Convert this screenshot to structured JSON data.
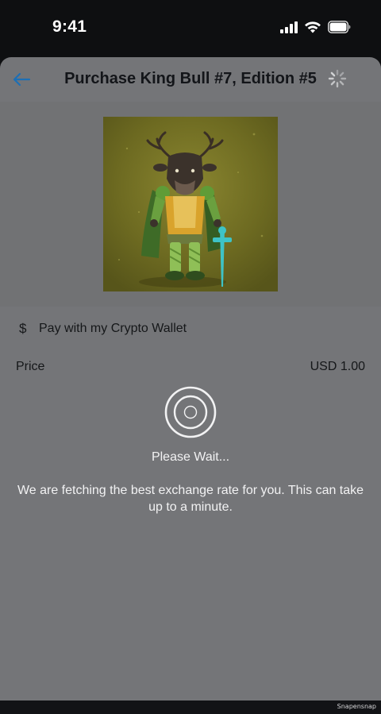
{
  "status_bar": {
    "time": "9:41",
    "icons": [
      "signal-icon",
      "wifi-icon",
      "battery-icon"
    ]
  },
  "header": {
    "back_icon": "arrow-left-icon",
    "title": "Purchase King Bull #7, Edition #5",
    "spinner_icon": "loading-spinner-icon",
    "accent_color": "#1d6fb5"
  },
  "artwork": {
    "icon": "bull-warrior-nft-image"
  },
  "payment": {
    "icon": "dollar-icon",
    "icon_glyph": "$",
    "label": "Pay with my Crypto Wallet"
  },
  "price": {
    "label": "Price",
    "value": "USD 1.00"
  },
  "loading": {
    "icon": "circular-loading-icon",
    "title": "Please Wait...",
    "message": "We are fetching the best exchange rate for you. This can take up to a minute."
  },
  "footer": {
    "watermark": "Snapensnap"
  }
}
